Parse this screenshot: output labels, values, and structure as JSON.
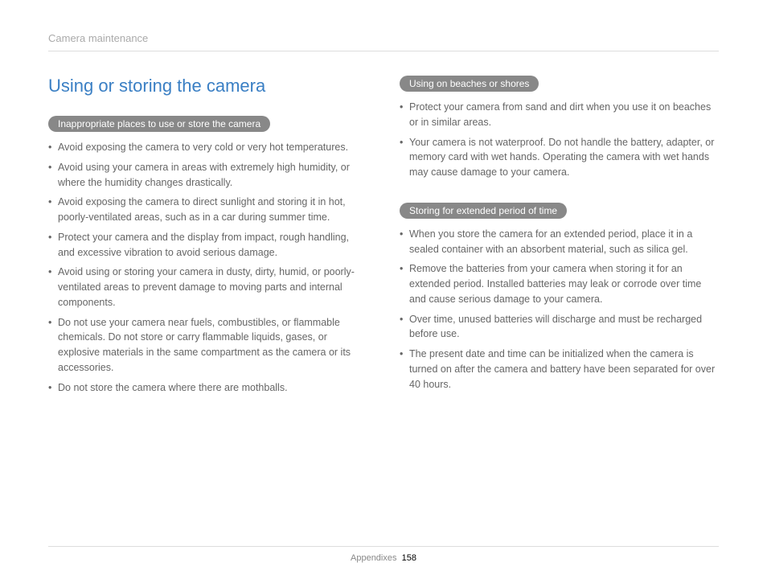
{
  "header": "Camera maintenance",
  "main_heading": "Using or storing the camera",
  "left": {
    "pill": "Inappropriate places to use or store the camera",
    "items": [
      "Avoid exposing the camera to very cold or very hot temperatures.",
      "Avoid using your camera in areas with extremely high humidity, or where the humidity changes drastically.",
      "Avoid exposing the camera to direct sunlight and storing it in hot, poorly-ventilated areas, such as in a car during summer time.",
      "Protect your camera and the display from impact, rough handling, and excessive vibration to avoid serious damage.",
      "Avoid using or storing your camera in dusty, dirty, humid, or poorly-ventilated areas to prevent damage to moving parts and internal components.",
      "Do not use your camera near fuels, combustibles, or flammable chemicals. Do not store or carry flammable liquids, gases, or explosive materials in the same compartment as the camera or its accessories.",
      "Do not store the camera where there are mothballs."
    ]
  },
  "right1": {
    "pill": "Using on beaches or shores",
    "items": [
      "Protect your camera from sand and dirt when you use it on beaches or in similar areas.",
      "Your camera is not waterproof. Do not handle the battery, adapter, or memory card with wet hands. Operating the camera with wet hands may cause damage to your camera."
    ]
  },
  "right2": {
    "pill": "Storing for extended period of time",
    "items": [
      "When you store the camera for an extended period, place it in a sealed container with an absorbent material, such as silica gel.",
      "Remove the batteries from your camera when storing it for an extended period. Installed batteries may leak or corrode over time and cause serious damage to your camera.",
      "Over time, unused batteries will discharge and must be recharged before use.",
      "The present date and time can be initialized when the camera is turned on after the camera and battery have been separated for over 40 hours."
    ]
  },
  "footer_label": "Appendixes",
  "page_number": "158"
}
